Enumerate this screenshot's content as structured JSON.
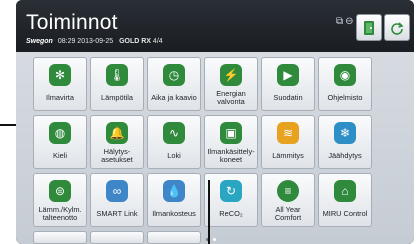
{
  "header": {
    "title": "Toiminnot",
    "brand": "Swegon",
    "datetime": "08:29 2013-09-25",
    "model": "GOLD RX",
    "unit": "4/4"
  },
  "colors": {
    "tile_icon_green": "#2f8a3c",
    "header_bg": "#1f2328",
    "content_bg": "#cfd4da"
  },
  "tiles": [
    {
      "label": "Ilmavirta",
      "icon": "fan-icon",
      "glyph": "✻"
    },
    {
      "label": "Lämpötila",
      "icon": "thermometer-icon",
      "glyph": "🌡"
    },
    {
      "label": "Aika ja kaavio",
      "icon": "clock-icon",
      "glyph": "◷"
    },
    {
      "label": "Energian valvonta",
      "icon": "energy-icon",
      "glyph": "⚡"
    },
    {
      "label": "Suodatin",
      "icon": "filter-icon",
      "glyph": "▶"
    },
    {
      "label": "Ohjelmisto",
      "icon": "software-icon",
      "glyph": "◉"
    },
    {
      "label": "Kieli",
      "icon": "globe-icon",
      "glyph": "◍"
    },
    {
      "label": "Hälytys-asetukset",
      "icon": "alarm-bell-icon",
      "glyph": "🔔"
    },
    {
      "label": "Loki",
      "icon": "log-chart-icon",
      "glyph": "∿"
    },
    {
      "label": "Ilmankäsittely-koneet",
      "icon": "air-handling-unit-icon",
      "glyph": "▣"
    },
    {
      "label": "Lämmitys",
      "icon": "heating-icon",
      "glyph": "≋"
    },
    {
      "label": "Jäähdytys",
      "icon": "snowflake-icon",
      "glyph": "❄"
    },
    {
      "label": "Lämm./Kylm. talteenotto",
      "icon": "heat-recovery-icon",
      "glyph": "⊜"
    },
    {
      "label": "SMART Link",
      "icon": "link-icon",
      "glyph": "∞"
    },
    {
      "label": "Ilmankosteus",
      "icon": "humidity-drops-icon",
      "glyph": "💧"
    },
    {
      "label": "ReCO₂",
      "icon": "co2-icon",
      "glyph": "↻"
    },
    {
      "label": "All Year Comfort",
      "icon": "all-year-comfort-icon",
      "glyph": "≡"
    },
    {
      "label": "MIRU Control",
      "icon": "home-control-icon",
      "glyph": "⌂"
    }
  ]
}
